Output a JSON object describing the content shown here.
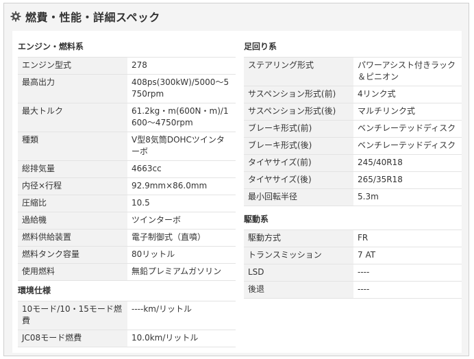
{
  "header": {
    "title": "燃費・性能・詳細スペック",
    "icon": "gear-icon"
  },
  "engine": {
    "title": "エンジン・燃料系",
    "rows": [
      {
        "label": "エンジン型式",
        "value": "278"
      },
      {
        "label": "最高出力",
        "value": "408ps(300kW)/5000〜5750rpm"
      },
      {
        "label": "最大トルク",
        "value": "61.2kg・m(600N・m)/1600〜4750rpm"
      },
      {
        "label": "種類",
        "value": "V型8気筒DOHCツインターボ"
      },
      {
        "label": "総排気量",
        "value": "4663cc"
      },
      {
        "label": "内径×行程",
        "value": "92.9mm×86.0mm"
      },
      {
        "label": "圧縮比",
        "value": "10.5"
      },
      {
        "label": "過給機",
        "value": "ツインターボ"
      },
      {
        "label": "燃料供給装置",
        "value": "電子制御式（直噴）"
      },
      {
        "label": "燃料タンク容量",
        "value": "80リットル"
      },
      {
        "label": "使用燃料",
        "value": "無鉛プレミアムガソリン"
      }
    ]
  },
  "environment": {
    "title": "環境仕様",
    "rows": [
      {
        "label": "10モード/10・15モード燃費",
        "value": "----km/リットル"
      },
      {
        "label": "JC08モード燃費",
        "value": "10.0km/リットル"
      }
    ]
  },
  "suspension": {
    "title": "足回り系",
    "rows": [
      {
        "label": "ステアリング形式",
        "value": "パワーアシスト付きラック＆ピニオン"
      },
      {
        "label": "サスペンション形式(前)",
        "value": "4リンク式"
      },
      {
        "label": "サスペンション形式(後)",
        "value": "マルチリンク式"
      },
      {
        "label": "ブレーキ形式(前)",
        "value": "ベンチレーテッドディスク"
      },
      {
        "label": "ブレーキ形式(後)",
        "value": "ベンチレーテッドディスク"
      },
      {
        "label": "タイヤサイズ(前)",
        "value": "245/40R18"
      },
      {
        "label": "タイヤサイズ(後)",
        "value": "265/35R18"
      },
      {
        "label": "最小回転半径",
        "value": "5.3m"
      }
    ]
  },
  "drive": {
    "title": "駆動系",
    "rows": [
      {
        "label": "駆動方式",
        "value": "FR"
      },
      {
        "label": "トランスミッション",
        "value": " 7 AT"
      },
      {
        "label": "LSD",
        "value": "----"
      },
      {
        "label": "後退",
        "value": "----"
      }
    ]
  }
}
